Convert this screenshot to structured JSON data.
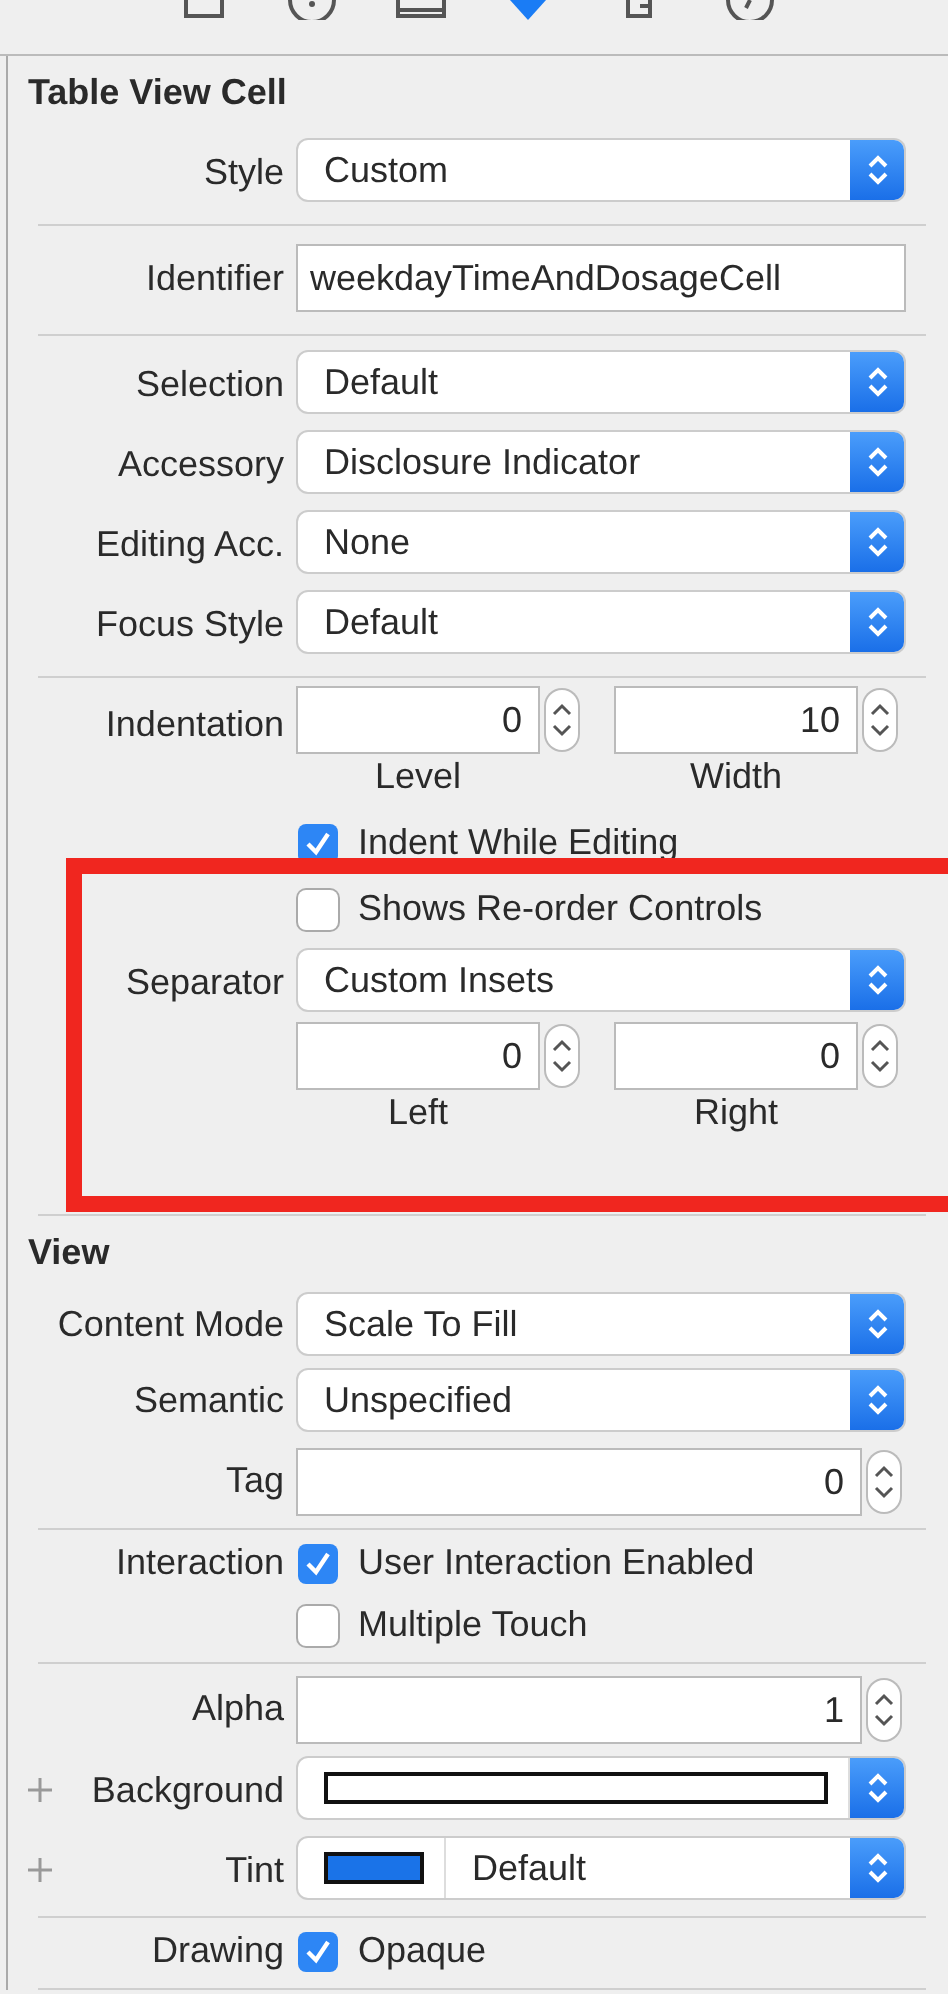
{
  "sections": [
    {
      "title": "Table View Cell",
      "groups": [
        [
          {
            "kind": "popup",
            "label": "Style",
            "value": "Custom"
          }
        ],
        [
          {
            "kind": "text",
            "label": "Identifier",
            "value": "weekdayTimeAndDosageCell"
          }
        ],
        [
          {
            "kind": "popup",
            "label": "Selection",
            "value": "Default"
          },
          {
            "kind": "popup",
            "label": "Accessory",
            "value": "Disclosure Indicator"
          },
          {
            "kind": "popup",
            "label": "Editing Acc.",
            "value": "None"
          },
          {
            "kind": "popup",
            "label": "Focus Style",
            "value": "Default"
          }
        ],
        [
          {
            "kind": "steppers",
            "label": "Indentation",
            "fields": [
              {
                "value": "0",
                "caption": "Level"
              },
              {
                "value": "10",
                "caption": "Width"
              }
            ]
          },
          {
            "kind": "checkbox",
            "text": "Indent While Editing",
            "checked": true
          },
          {
            "kind": "checkbox",
            "text": "Shows Re-order Controls",
            "checked": false
          },
          {
            "kind": "popup",
            "label": "Separator",
            "value": "Custom Insets"
          },
          {
            "kind": "steppers",
            "fields": [
              {
                "value": "0",
                "caption": "Left"
              },
              {
                "value": "0",
                "caption": "Right"
              }
            ]
          }
        ]
      ]
    },
    {
      "title": "View",
      "groups": [
        [
          {
            "kind": "popup",
            "label": "Content Mode",
            "value": "Scale To Fill"
          },
          {
            "kind": "popup",
            "label": "Semantic",
            "value": "Unspecified"
          },
          {
            "kind": "number",
            "label": "Tag",
            "value": "0"
          }
        ],
        [
          {
            "kind": "checkbox",
            "label": "Interaction",
            "text": "User Interaction Enabled",
            "checked": true
          },
          {
            "kind": "checkbox",
            "text": "Multiple Touch",
            "checked": false
          }
        ],
        [
          {
            "kind": "number",
            "label": "Alpha",
            "value": "1"
          },
          {
            "kind": "color",
            "label": "Background",
            "color": "#ffffff"
          },
          {
            "kind": "color",
            "label": "Tint",
            "color": "#1a73e8",
            "value": "Default"
          }
        ],
        [
          {
            "kind": "checkbox",
            "label": "Drawing",
            "text": "Opaque",
            "checked": true
          }
        ]
      ]
    }
  ]
}
